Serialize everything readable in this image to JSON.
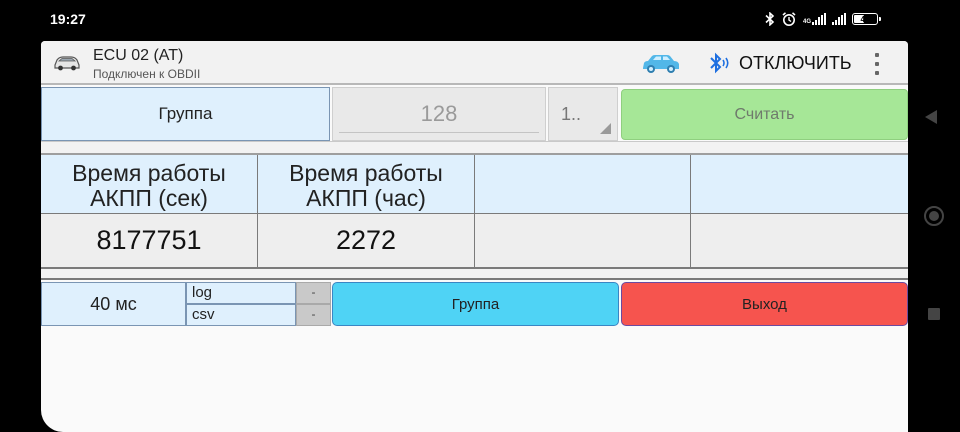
{
  "status_bar": {
    "time": "19:27",
    "icons": [
      "bluetooth-icon",
      "alarm-icon",
      "network-4g-icon",
      "signal-icon",
      "battery-icon"
    ],
    "network_label": "4G",
    "battery_level": "40"
  },
  "appbar": {
    "title": "ECU 02 (AT)",
    "subtitle": "Подключен к OBDII",
    "disconnect_label": "ОТКЛЮЧИТЬ",
    "accent_car_color": "#52b7e8",
    "bluetooth_color": "#1e6fe0"
  },
  "controls": {
    "group_label": "Группа",
    "group_number": "128",
    "group_select_value": "1..",
    "read_button": "Считать",
    "read_button_color": "#a6e797"
  },
  "table": {
    "headers": [
      "Время работы АКПП (сек)",
      "Время работы АКПП (час)",
      "",
      ""
    ],
    "values": [
      "8177751",
      "2272",
      "",
      ""
    ]
  },
  "bottom": {
    "interval": "40 мс",
    "log_label": "log",
    "csv_label": "csv",
    "log_button": "-",
    "csv_button": "-",
    "group_button": "Группа",
    "exit_button": "Выход",
    "group_button_color": "#4fd3f5",
    "exit_button_color": "#f6544e"
  }
}
